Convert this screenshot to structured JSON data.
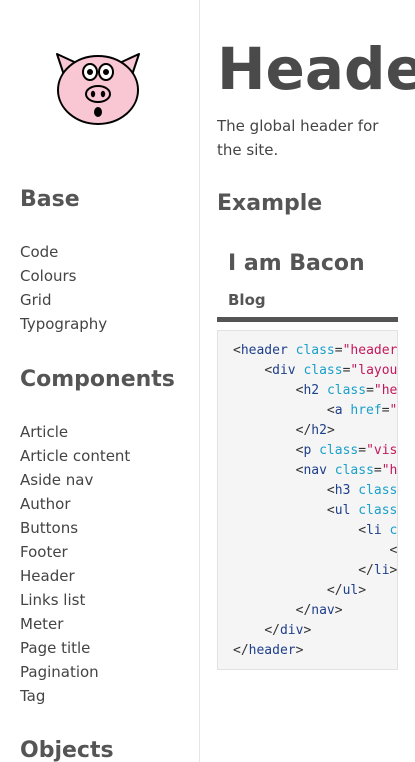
{
  "sidebar": {
    "groups": [
      {
        "heading": "Base",
        "items": [
          "Code",
          "Colours",
          "Grid",
          "Typography"
        ]
      },
      {
        "heading": "Components",
        "items": [
          "Article",
          "Article content",
          "Aside nav",
          "Author",
          "Buttons",
          "Footer",
          "Header",
          "Links list",
          "Meter",
          "Page title",
          "Pagination",
          "Tag"
        ]
      },
      {
        "heading": "Objects",
        "items": []
      }
    ]
  },
  "main": {
    "title": "Header",
    "description": "The global header for the site.",
    "example_heading": "Example",
    "example": {
      "site_title": "I am Bacon",
      "nav_link": "Blog"
    },
    "code_lines": [
      "<header class=\"header",
      "    <div class=\"layou",
      "        <h2 class=\"he",
      "            <a href=\"",
      "        </h2>",
      "        <p class=\"vis",
      "        <nav class=\"h",
      "            <h3 class",
      "            <ul class",
      "                <li c",
      "                    <",
      "                </li>",
      "            </ul>",
      "        </nav>",
      "    </div>",
      "</header>"
    ]
  },
  "colors": {
    "heading": "#555555",
    "text": "#444444",
    "tag": "#1e3f8a",
    "attribute": "#1aa0c9",
    "string": "#c2185b",
    "code_bg": "#f5f5f5",
    "rule": "#555555",
    "pig_pink": "#f9c6d3"
  },
  "icons": {
    "logo": "pig-face-logo"
  }
}
